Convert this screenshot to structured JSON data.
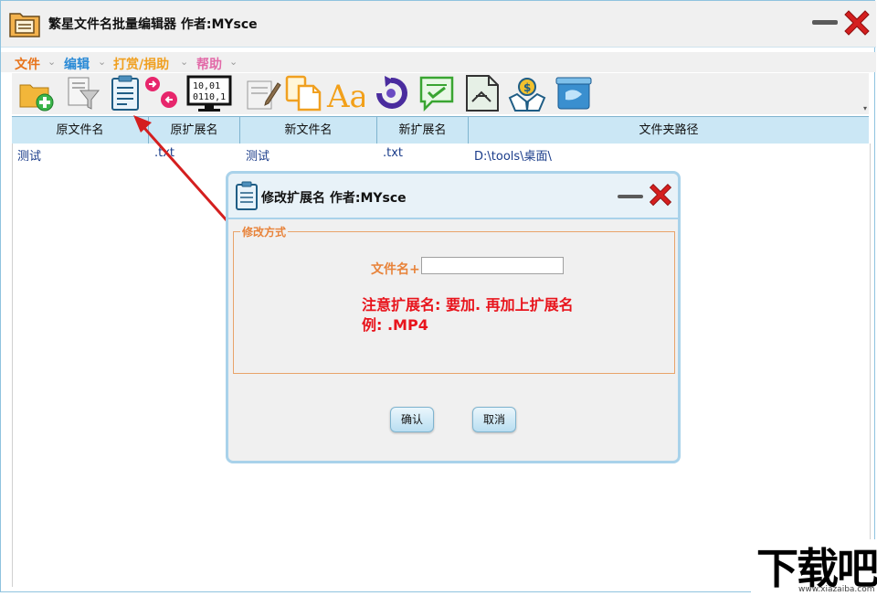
{
  "window": {
    "title": "繁星文件名批量编辑器  作者:MYsce"
  },
  "menu": [
    {
      "label": "文件",
      "color": "#e8731a"
    },
    {
      "label": "编辑",
      "color": "#2a8ad6"
    },
    {
      "label": "打赏/捐助",
      "color": "#f0a020"
    },
    {
      "label": "帮助",
      "color": "#e26aa8"
    }
  ],
  "menu_chevron": "⌄",
  "toolbar": {
    "icons": [
      "add-folder-icon",
      "filter-icon",
      "edit-extension-icon",
      "swap-icon",
      "numbering-icon",
      "rename-icon",
      "copy-paste-icon",
      "font-case-icon",
      "undo-icon",
      "checklist-icon",
      "file-compare-icon",
      "donate-icon",
      "clean-icon"
    ],
    "overflow": "▾"
  },
  "table": {
    "columns": [
      "原文件名",
      "原扩展名",
      "新文件名",
      "新扩展名",
      "文件夹路径"
    ],
    "rows": [
      {
        "orig_name": "测试",
        "orig_ext": ".txt",
        "new_name": "测试",
        "new_ext": ".txt",
        "path": "D:\\tools\\桌面\\"
      }
    ]
  },
  "dialog": {
    "title": "修改扩展名  作者:MYsce",
    "group_label": "修改方式",
    "filename_label": "文件名+",
    "filename_value": "",
    "note_line1": "注意扩展名: 要加. 再加上扩展名",
    "note_line2": "例: .MP4",
    "ok_label": "确认",
    "cancel_label": "取消"
  },
  "watermark": {
    "text": "下载吧",
    "url": "www.xiazaiba.com"
  },
  "colors": {
    "accent": "#cbe7f5",
    "close": "#d41f1f",
    "note": "#e8141c",
    "legend": "#e8833a"
  }
}
